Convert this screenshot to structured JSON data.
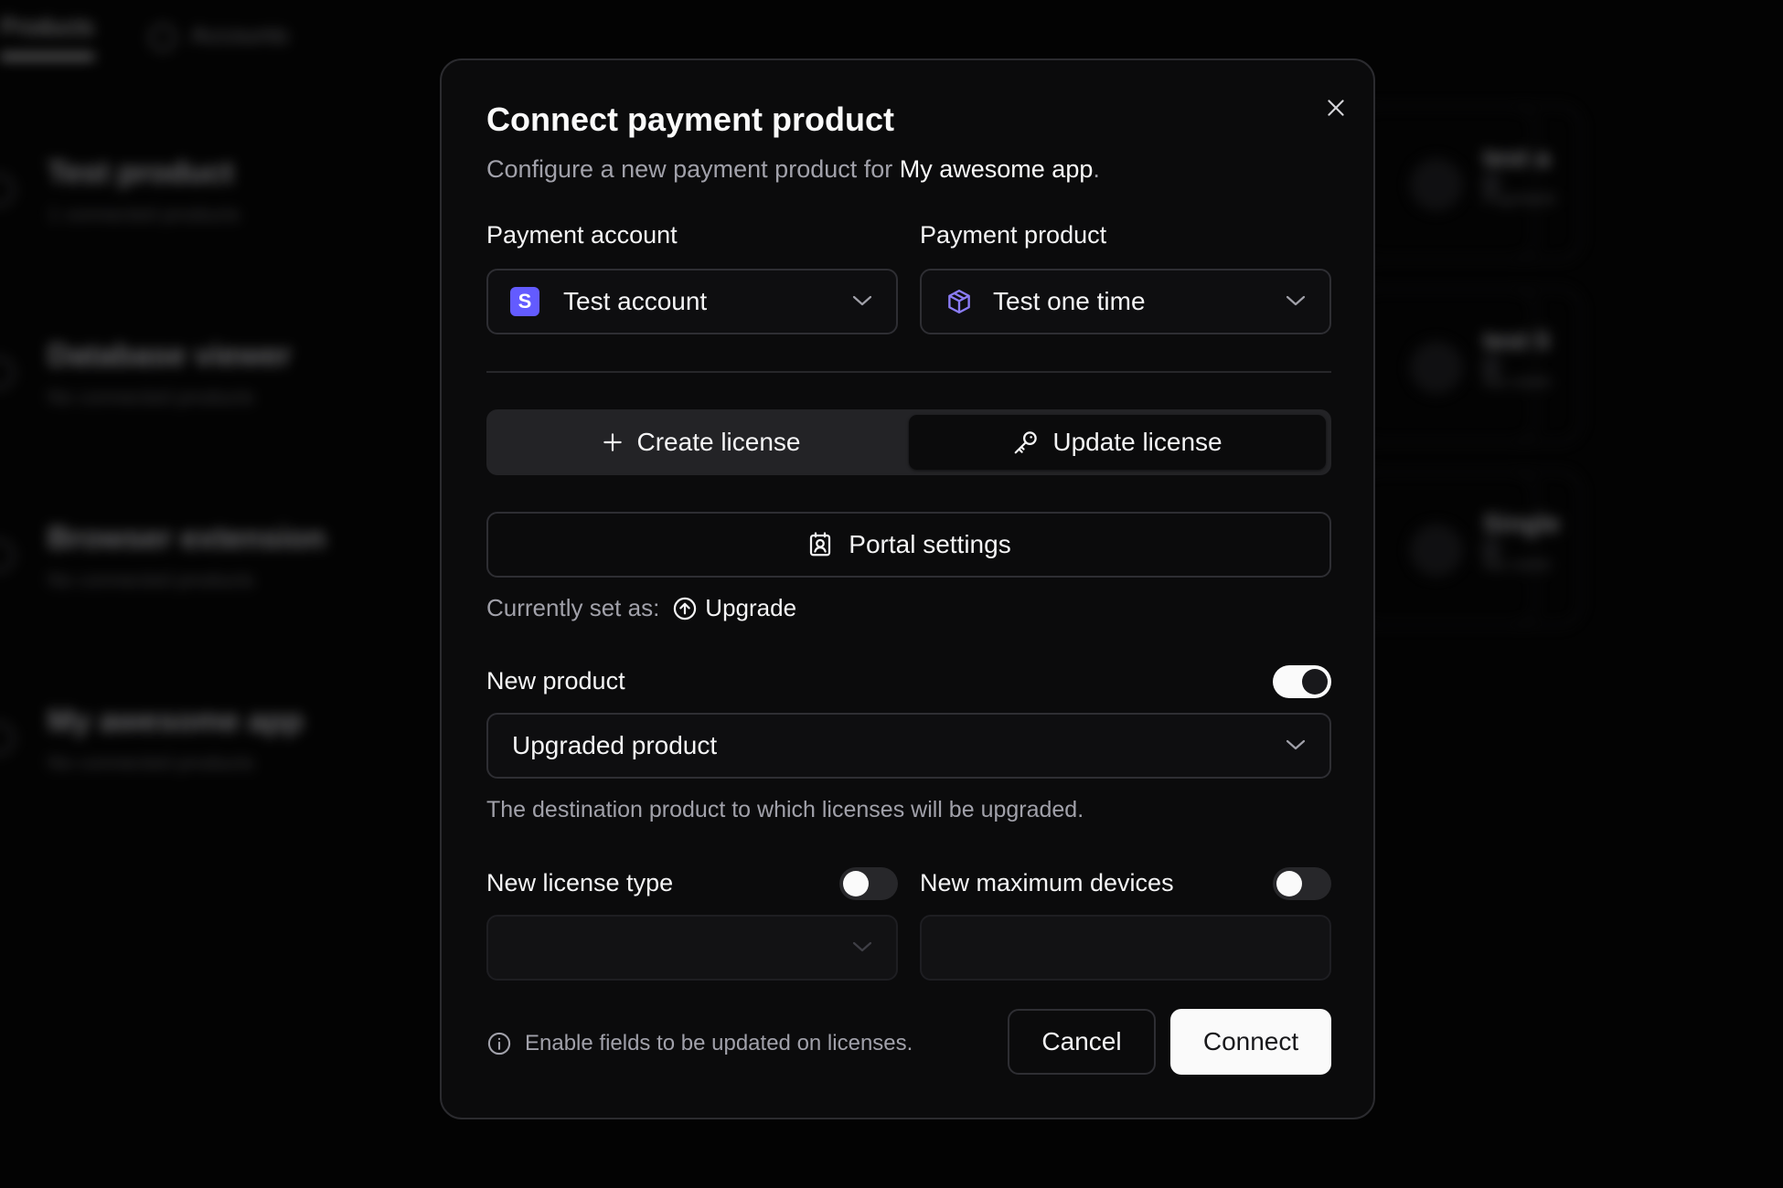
{
  "background": {
    "tabs": [
      "Products",
      "Accounts"
    ],
    "cards": [
      {
        "title": "Test product",
        "subtitle": "1 connected products"
      },
      {
        "title": "Database viewer",
        "subtitle": "No connected products"
      },
      {
        "title": "Browser extension",
        "subtitle": "No connected products"
      },
      {
        "title": "My awesome app",
        "subtitle": "No connected products"
      }
    ],
    "right_cards": [
      {
        "title": "test a",
        "subtitle": "Payment"
      },
      {
        "title": "test li",
        "subtitle": "No conn"
      },
      {
        "title": "Single",
        "subtitle": "No conn"
      }
    ]
  },
  "modal": {
    "title": "Connect payment product",
    "subtitle_prefix": "Configure a new payment product for ",
    "app_name": "My awesome app",
    "subtitle_suffix": ".",
    "payment_account": {
      "label": "Payment account",
      "value": "Test account",
      "icon_letter": "S"
    },
    "payment_product": {
      "label": "Payment product",
      "value": "Test one time"
    },
    "tabs": {
      "create": "Create license",
      "update": "Update license",
      "active": "update"
    },
    "portal_settings": "Portal settings",
    "current_prefix": "Currently set as:",
    "current_value": "Upgrade",
    "new_product": {
      "label": "New product",
      "enabled": true,
      "value": "Upgraded product",
      "hint": "The destination product to which licenses will be upgraded."
    },
    "new_license_type": {
      "label": "New license type",
      "enabled": false
    },
    "new_max_devices": {
      "label": "New maximum devices",
      "enabled": false
    },
    "footer_note": "Enable fields to be updated on licenses.",
    "cancel": "Cancel",
    "connect": "Connect"
  },
  "colors": {
    "accent_stripe": "#635bff",
    "product_icon": "#8b7cf6"
  }
}
